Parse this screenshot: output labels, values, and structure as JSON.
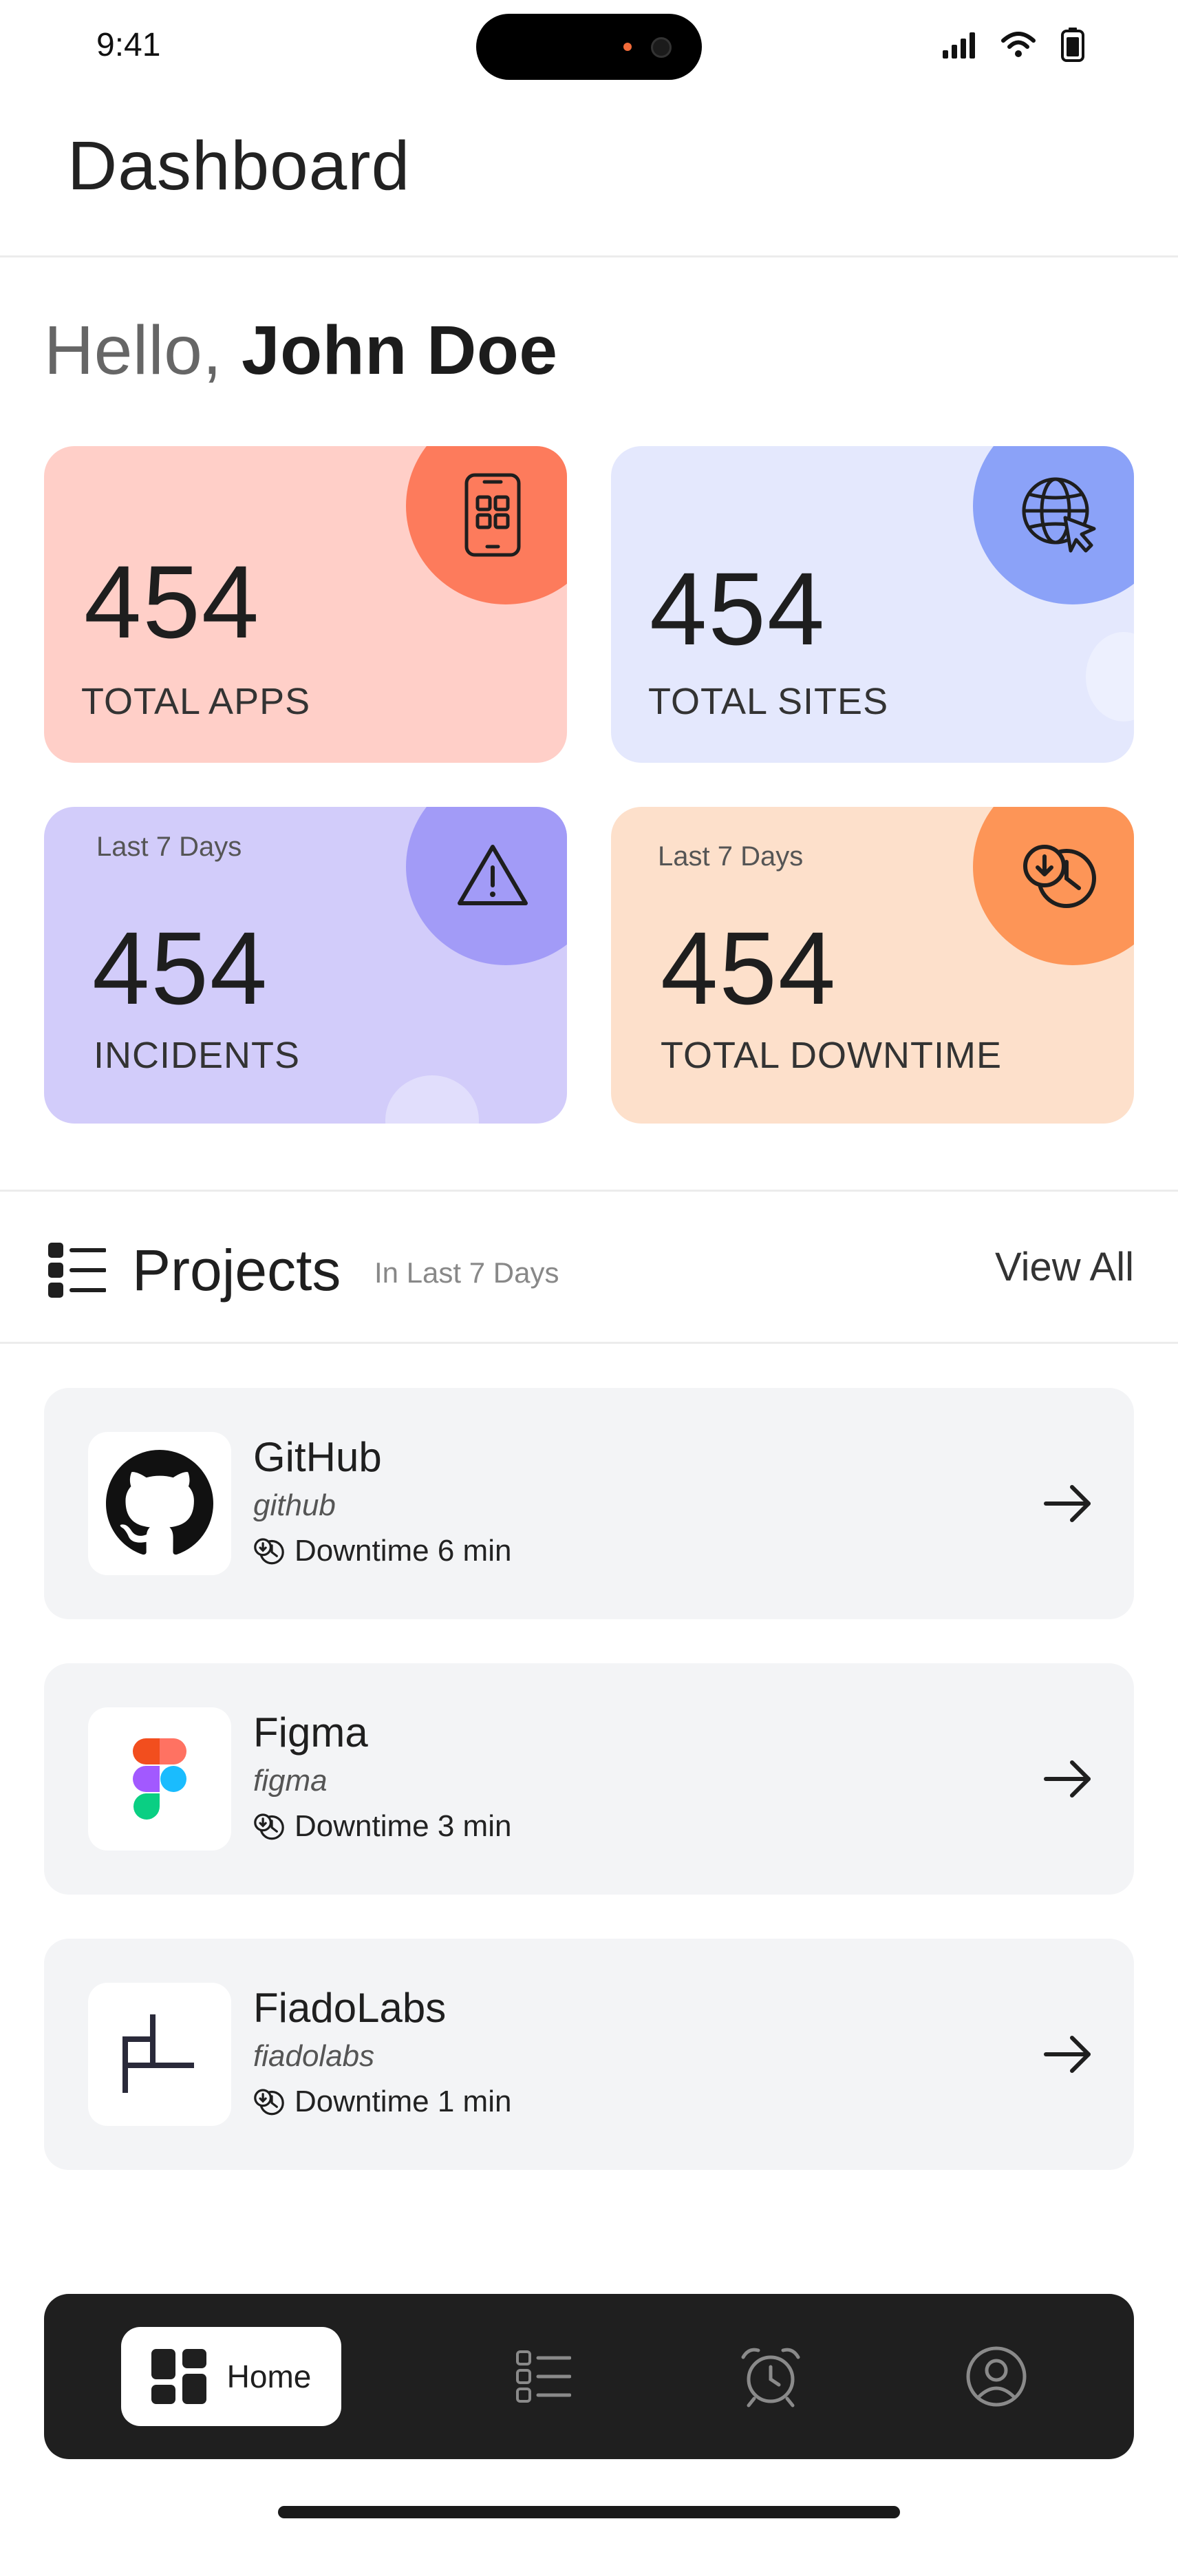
{
  "status_bar": {
    "time": "9:41"
  },
  "header": {
    "title": "Dashboard"
  },
  "greeting": {
    "prefix": "Hello, ",
    "name": "John Doe"
  },
  "stats": {
    "apps": {
      "value": "454",
      "label": "TOTAL APPS",
      "icon": "mobile-app-icon"
    },
    "sites": {
      "value": "454",
      "label": "TOTAL SITES",
      "icon": "globe-cursor-icon"
    },
    "incidents": {
      "period": "Last 7 Days",
      "value": "454",
      "label": "INCIDENTS",
      "icon": "warning-icon"
    },
    "downtime": {
      "period": "Last 7 Days",
      "value": "454",
      "label": "TOTAL DOWNTIME",
      "icon": "downtime-clock-icon"
    }
  },
  "projects": {
    "title": "Projects",
    "subtitle": "In Last 7 Days",
    "view_all": "View All",
    "items": [
      {
        "name": "GitHub",
        "slug": "github",
        "downtime": "Downtime 6 min",
        "icon": "github-logo"
      },
      {
        "name": "Figma",
        "slug": "figma",
        "downtime": "Downtime 3 min",
        "icon": "figma-logo"
      },
      {
        "name": "FiadoLabs",
        "slug": "fiadolabs",
        "downtime": "Downtime 1 min",
        "icon": "fiadolabs-logo"
      }
    ]
  },
  "nav": {
    "home_label": "Home",
    "items": [
      "home-icon",
      "list-icon",
      "alarm-clock-icon",
      "profile-icon"
    ]
  },
  "colors": {
    "apps_bg": "#ffcfc8",
    "apps_accent": "#fd7b5c",
    "sites_bg": "#e4e8fd",
    "sites_accent": "#8ba2f8",
    "incidents_bg": "#d2ccfa",
    "incidents_accent": "#a29bf7",
    "downtime_bg": "#fde0cb",
    "downtime_accent": "#fd9557",
    "nav_bg": "#1f1f1f"
  }
}
